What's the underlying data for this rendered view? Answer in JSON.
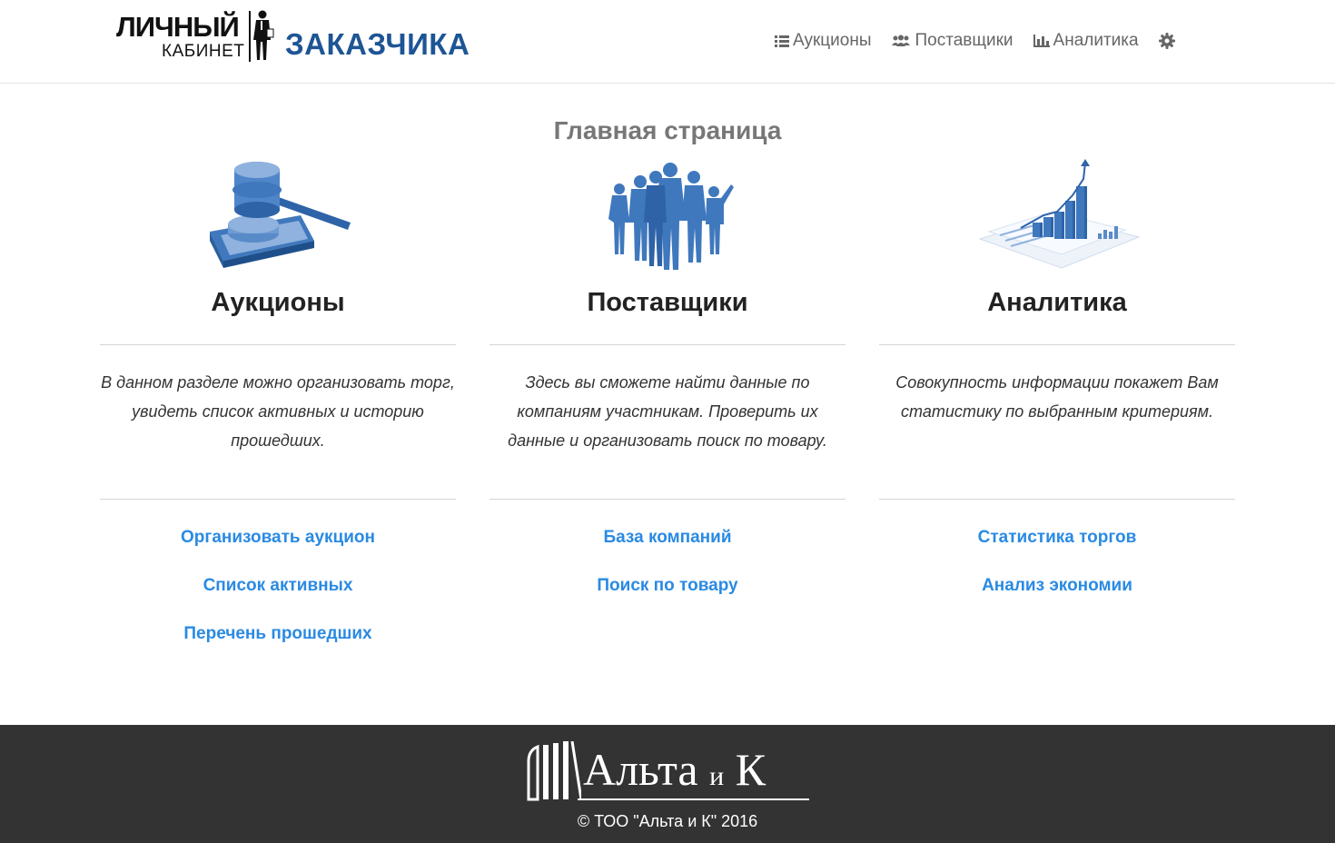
{
  "header": {
    "logo": {
      "line1": "ЛИЧНЫЙ",
      "line2": "КАБИНЕТ",
      "line3": "ЗАКАЗЧИКА"
    },
    "nav": [
      {
        "label": "Аукционы",
        "icon": "list-icon"
      },
      {
        "label": "Поставщики",
        "icon": "users-icon"
      },
      {
        "label": "Аналитика",
        "icon": "bar-chart-icon"
      }
    ],
    "settings_icon": "gear-icon"
  },
  "main": {
    "title": "Главная страница",
    "columns": [
      {
        "title": "Аукционы",
        "image": "gavel-illustration",
        "description": "В данном разделе можно организовать торг, увидеть список активных и историю прошедших.",
        "links": [
          "Организовать аукцион",
          "Список активных",
          "Перечень прошедших"
        ]
      },
      {
        "title": "Поставщики",
        "image": "business-people-illustration",
        "description": "Здесь вы сможете найти данные по компаниям участникам. Проверить их данные и организовать поиск по товару.",
        "links": [
          "База компаний",
          "Поиск по товару"
        ]
      },
      {
        "title": "Аналитика",
        "image": "growth-chart-illustration",
        "description": "Совокупность информации покажет Вам статистику по выбранным критериям.",
        "links": [
          "Статистика торгов",
          "Анализ экономии"
        ]
      }
    ]
  },
  "footer": {
    "brand": "Альта",
    "brand_mid": "и",
    "brand_end": "К",
    "copyright": "© ТОО \"Альта и К\" 2016"
  },
  "colors": {
    "brand_blue": "#1d5595",
    "link_blue": "#2a8ae3",
    "illustration_blue": "#3f78bd",
    "footer_bg": "#333333",
    "nav_text": "#666666"
  }
}
